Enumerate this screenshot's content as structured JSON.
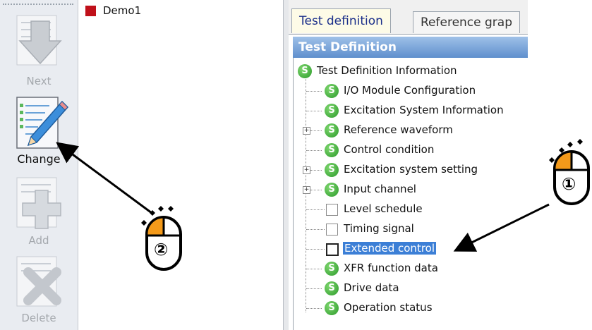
{
  "toolbar": {
    "buttons": [
      {
        "label": "Next",
        "enabled": false
      },
      {
        "label": "Change",
        "enabled": true
      },
      {
        "label": "Add",
        "enabled": false
      },
      {
        "label": "Delete",
        "enabled": false
      }
    ]
  },
  "project_tree": {
    "root_label": "Demo1"
  },
  "tabs": [
    {
      "label": "Test definition",
      "active": true
    },
    {
      "label": "Reference grap",
      "active": false
    }
  ],
  "panel": {
    "header": "Test Definition",
    "root": "Test Definition Information",
    "items": [
      {
        "label": "I/O Module Configuration",
        "icon": "s-status-icon",
        "expandable": false
      },
      {
        "label": "Excitation System Information",
        "icon": "s-status-icon",
        "expandable": false
      },
      {
        "label": "Reference waveform",
        "icon": "s-status-icon",
        "expandable": true
      },
      {
        "label": "Control condition",
        "icon": "s-status-icon",
        "expandable": false
      },
      {
        "label": "Excitation system setting",
        "icon": "s-status-icon",
        "expandable": true
      },
      {
        "label": "Input channel",
        "icon": "s-status-icon",
        "expandable": true
      },
      {
        "label": "Level schedule",
        "icon": "empty-box-icon",
        "expandable": false
      },
      {
        "label": "Timing signal",
        "icon": "empty-box-icon",
        "expandable": false
      },
      {
        "label": "Extended control",
        "icon": "empty-box-icon",
        "expandable": false,
        "selected": true
      },
      {
        "label": "XFR function data",
        "icon": "s-status-icon",
        "expandable": false
      },
      {
        "label": "Drive data",
        "icon": "s-status-icon",
        "expandable": false
      },
      {
        "label": "Operation status",
        "icon": "s-status-icon",
        "expandable": false
      }
    ]
  },
  "annotations": {
    "step1": "①",
    "step2": "②"
  },
  "colors": {
    "selection": "#3c7fd6",
    "header_blue": "#5f8fcd",
    "mouse_orange": "#f49a1a",
    "status_green": "#2b9a2a",
    "demo_red": "#c0101a"
  }
}
